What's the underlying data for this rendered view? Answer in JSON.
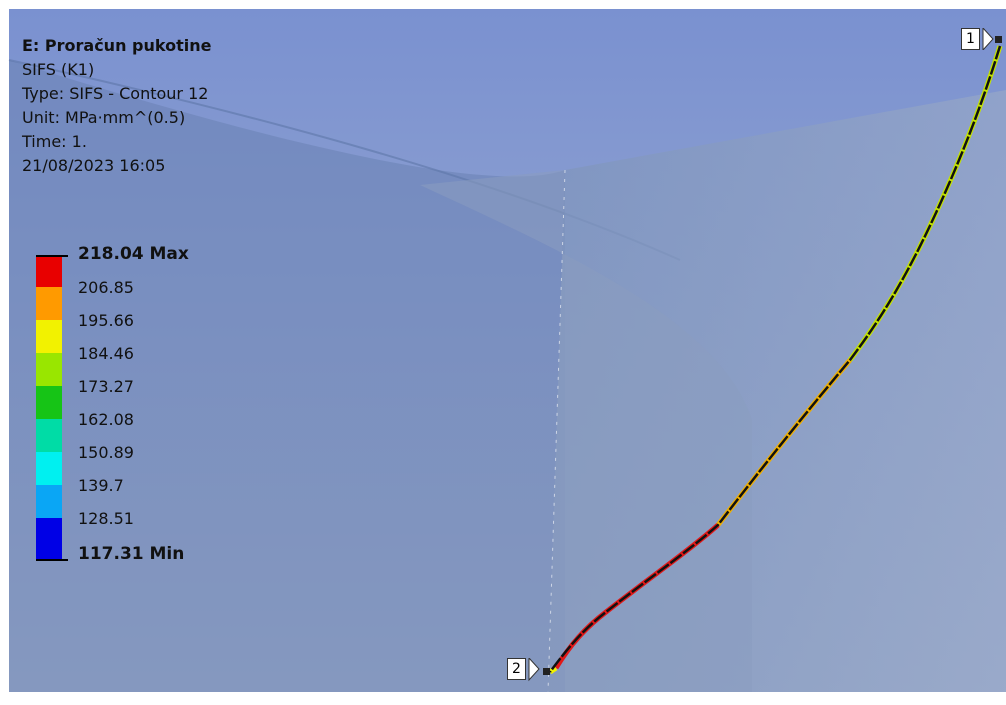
{
  "info": {
    "title": "E: Proračun pukotine",
    "result": "SIFS (K1)",
    "type": "Type: SIFS - Contour 12",
    "unit": "Unit: MPa·mm^(0.5)",
    "time": "Time: 1.",
    "timestamp": "21/08/2023 16:05"
  },
  "legend": {
    "max_label": "218.04 Max",
    "min_label": "117.31 Min",
    "ticks": [
      "206.85",
      "195.66",
      "184.46",
      "173.27",
      "162.08",
      "150.89",
      "139.7",
      "128.51"
    ],
    "colors": [
      "#e80000",
      "#ff9a00",
      "#f2f200",
      "#99e600",
      "#16c416",
      "#00dca6",
      "#00f0f0",
      "#0aa6f5",
      "#0000e6"
    ]
  },
  "probes": {
    "p1": "1",
    "p2": "2"
  },
  "colors": {
    "background": "#7d93c8",
    "crack_line": "#111111"
  }
}
